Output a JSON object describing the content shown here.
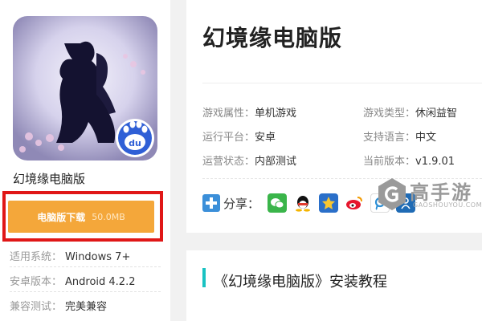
{
  "app": {
    "title": "幻境缘电脑版",
    "icon_badge": "du"
  },
  "download": {
    "label": "电脑版下载",
    "size": "50.0MB"
  },
  "specs": [
    {
      "label": "适用系统：",
      "value": "Windows 7+"
    },
    {
      "label": "安卓版本：",
      "value": "Android 4.2.2"
    },
    {
      "label": "兼容测试：",
      "value": "完美兼容"
    }
  ],
  "page_title": "幻境缘电脑版",
  "info": [
    {
      "label": "游戏属性：",
      "value": "单机游戏"
    },
    {
      "label": "游戏类型：",
      "value": "休闲益智"
    },
    {
      "label": "运行平台：",
      "value": "安卓"
    },
    {
      "label": "支持语言：",
      "value": "中文"
    },
    {
      "label": "运营状态：",
      "value": "内部测试"
    },
    {
      "label": "当前版本：",
      "value": "v1.9.01"
    }
  ],
  "share": {
    "label": "分享：",
    "icons": [
      "wechat-icon",
      "qq-icon",
      "qzone-icon",
      "weibo-icon",
      "tencent-weibo-icon",
      "renren-icon"
    ]
  },
  "brand": {
    "name": "高手游",
    "domain": "GAOSHOUYOU.COM"
  },
  "tutorial": {
    "title": "《幻境缘电脑版》安装教程"
  },
  "colors": {
    "download_button": "#f4a73a",
    "highlight_frame": "#e01717",
    "accent_bar": "#19c2c2"
  }
}
